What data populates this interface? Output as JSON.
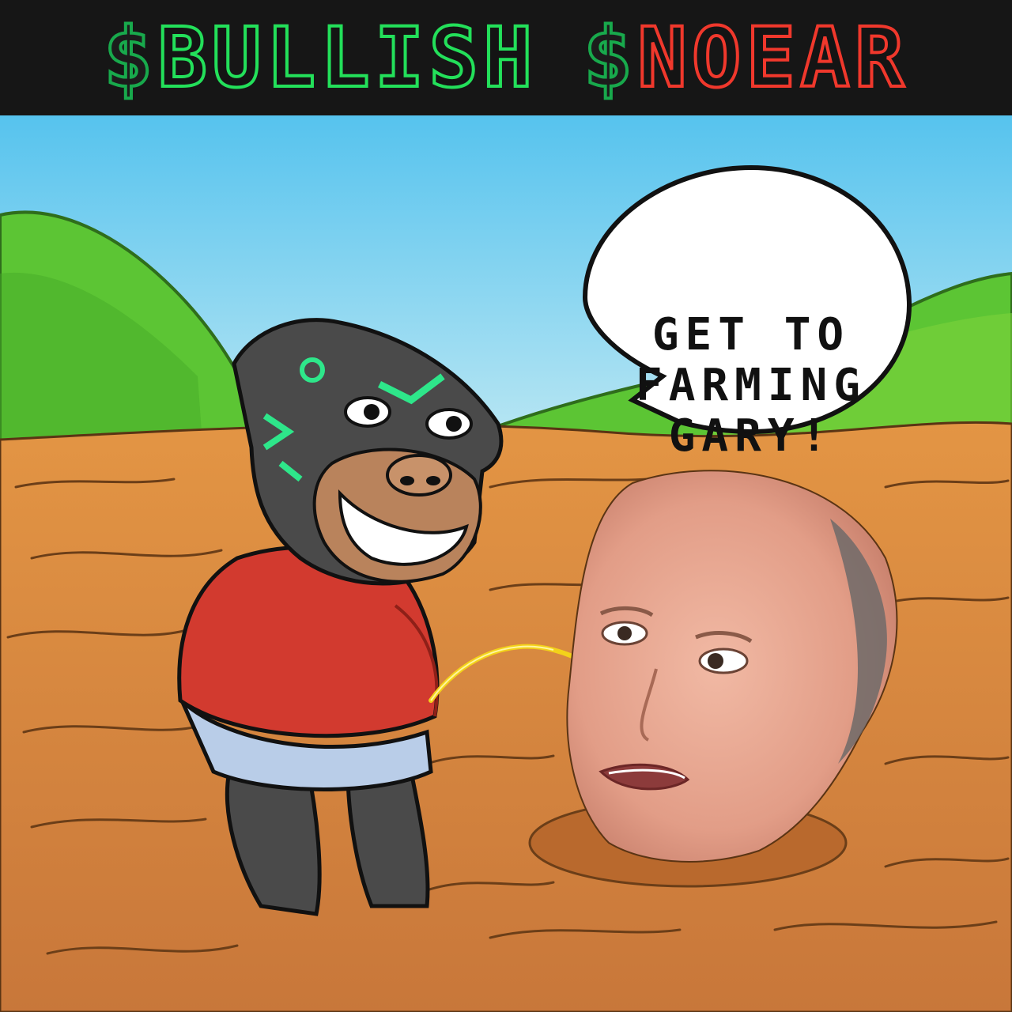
{
  "header": {
    "bull_symbol": "$",
    "bull_word": "BULLISH",
    "bear_symbol": "$",
    "bear_word": "NOEAR",
    "colors": {
      "background": "#161616",
      "dollar": "#18a94c",
      "bull": "#23e05a",
      "bear": "#f0382c"
    }
  },
  "speech_bubble": {
    "lines": [
      "GET TO",
      "FARMING",
      "GARY!"
    ]
  },
  "scene": {
    "colors": {
      "sky_top": "#56c3ee",
      "sky_bottom": "#c9ecf4",
      "hills": "#5cc534",
      "dirt": "#d9863c",
      "shirt": "#d23a2f",
      "diaper": "#b9cde8",
      "character_body": "#4a4a4a",
      "accent": "#2ee68a",
      "stream": "#f3d21a"
    },
    "icons": [
      "gorilla-character",
      "bald-man-head",
      "speech-bubble"
    ]
  }
}
